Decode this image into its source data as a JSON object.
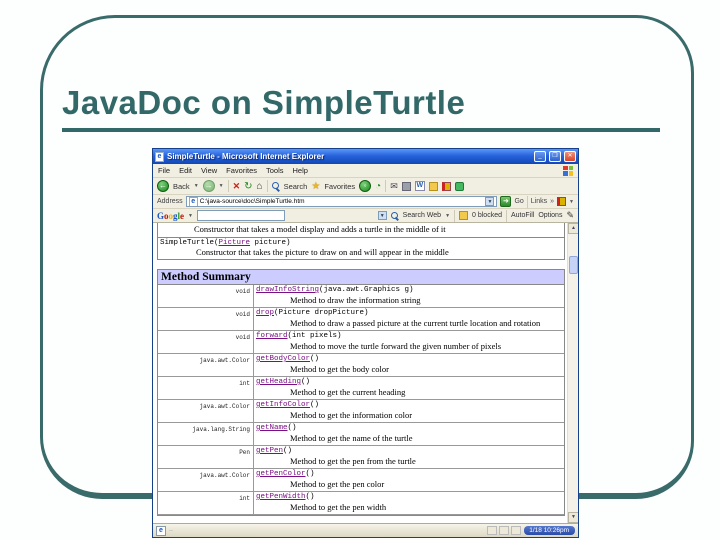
{
  "slide": {
    "title": "JavaDoc on SimpleTurtle"
  },
  "browser": {
    "window_title": "SimpleTurtle - Microsoft Internet Explorer",
    "window_buttons": {
      "minimize": "_",
      "restore": "❐",
      "close": "✕"
    },
    "menus": [
      "File",
      "Edit",
      "View",
      "Favorites",
      "Tools",
      "Help"
    ],
    "toolbar": {
      "back_label": "Back",
      "search_label": "Search",
      "favorites_label": "Favorites"
    },
    "address": {
      "label": "Address",
      "url": "C:\\java-source\\doc\\SimpleTurtle.htm",
      "go_label": "Go",
      "links_label": "Links",
      "links_chevron": "»"
    },
    "google": {
      "logo": "Google",
      "logo_colors": [
        "#1a55c0",
        "#c41200",
        "#eeb211",
        "#1a55c0",
        "#289a28",
        "#c41200"
      ],
      "search_value": "",
      "search_web_label": "Search Web",
      "blocked_label": "0 blocked",
      "autofill_label": "AutoFill",
      "options_label": "Options"
    },
    "taskbar": {
      "clock": "1/18 10:26pm"
    }
  },
  "javadoc": {
    "ctor_prev_desc": "Constructor that takes a model display and adds a turtle in the middle of it",
    "ctor_sig_pre": "SimpleTurtle(",
    "ctor_sig_link": "Picture",
    "ctor_sig_post": " picture)",
    "ctor_desc": "Constructor that takes the picture to draw on and will appear in the middle",
    "method_summary_title": "Method Summary",
    "methods": [
      {
        "type": "void",
        "name": "drawInfoString",
        "params": "(java.awt.Graphics g)",
        "desc": "Method to draw the information string"
      },
      {
        "type": "void",
        "name": "drop",
        "params": "(Picture dropPicture)",
        "desc": "Method to draw a passed picture at the current turtle location and rotation"
      },
      {
        "type": "void",
        "name": "forward",
        "params": "(int pixels)",
        "desc": "Method to move the turtle forward the given number of pixels"
      },
      {
        "type": "java.awt.Color",
        "name": "getBodyColor",
        "params": "()",
        "desc": "Method to get the body color"
      },
      {
        "type": "int",
        "name": "getHeading",
        "params": "()",
        "desc": "Method to get the current heading"
      },
      {
        "type": "java.awt.Color",
        "name": "getInfoColor",
        "params": "()",
        "desc": "Method to get the information color"
      },
      {
        "type": "java.lang.String",
        "name": "getName",
        "params": "()",
        "desc": "Method to get the name of the turtle"
      },
      {
        "type": "Pen",
        "name": "getPen",
        "params": "()",
        "desc": "Method to get the pen from the turtle"
      },
      {
        "type": "java.awt.Color",
        "name": "getPenColor",
        "params": "()",
        "desc": "Method to get the pen color"
      },
      {
        "type": "int",
        "name": "getPenWidth",
        "params": "()",
        "desc": "Method to get the pen width"
      }
    ]
  }
}
